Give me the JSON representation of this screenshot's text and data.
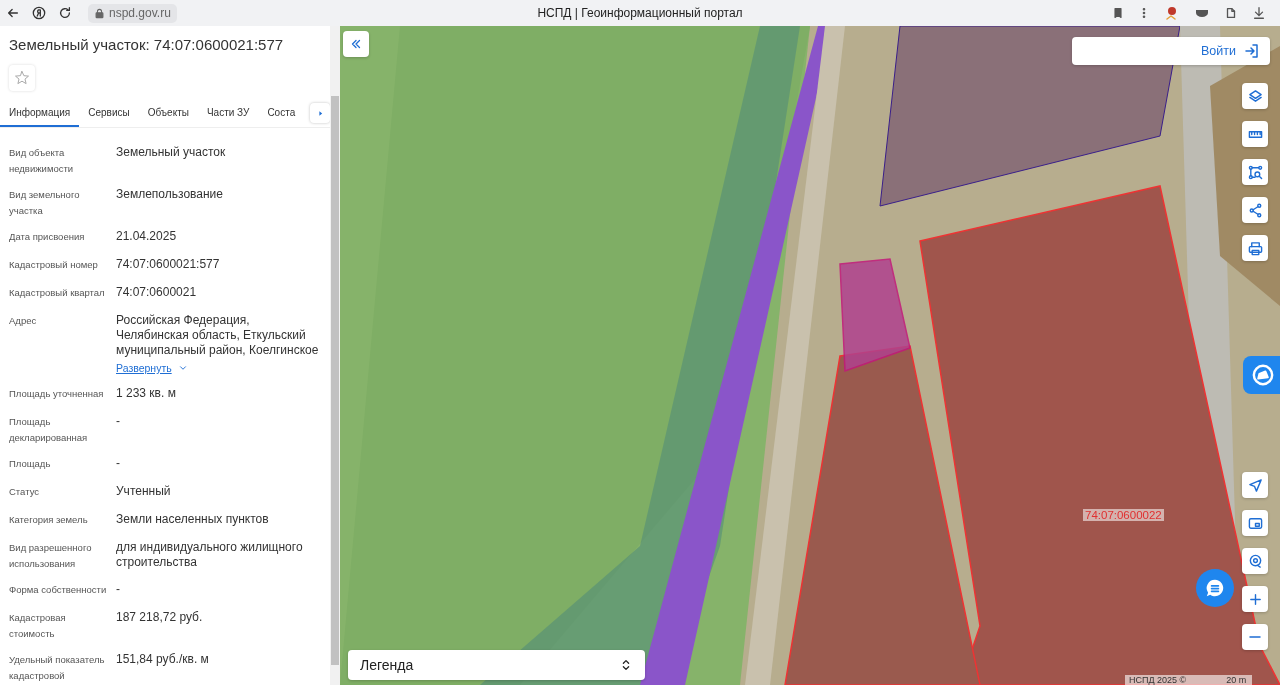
{
  "browser": {
    "url": "nspd.gov.ru",
    "title": "НСПД | Геоинформационный портал"
  },
  "panel": {
    "title": "Земельный участок: 74:07:0600021:577",
    "tabs": [
      {
        "label": "Информация",
        "selected": true
      },
      {
        "label": "Сервисы",
        "selected": false
      },
      {
        "label": "Объекты",
        "selected": false
      },
      {
        "label": "Части ЗУ",
        "selected": false
      },
      {
        "label": "Соста",
        "selected": false
      }
    ],
    "properties": [
      {
        "label": "Вид объекта недвижимости",
        "value": "Земельный участок"
      },
      {
        "label": "Вид земельного участка",
        "value": "Землепользование"
      },
      {
        "label": "Дата присвоения",
        "value": "21.04.2025"
      },
      {
        "label": "Кадастровый номер",
        "value": "74:07:0600021:577"
      },
      {
        "label": "Кадастровый квартал",
        "value": "74:07:0600021"
      },
      {
        "label": "Адрес",
        "value": "Российская Федерация, Челябинская область, Еткульский муниципальный район, Коелгинское",
        "link": "Развернуть"
      },
      {
        "label": "Площадь уточненная",
        "value": "1 233 кв. м"
      },
      {
        "label": "Площадь декларированная",
        "value": "-"
      },
      {
        "label": "Площадь",
        "value": "-"
      },
      {
        "label": "Статус",
        "value": "Учтенный"
      },
      {
        "label": "Категория земель",
        "value": "Земли населенных пунктов"
      },
      {
        "label": "Вид разрешенного использования",
        "value": "для индивидуального жилищного строительства"
      },
      {
        "label": "Форма собственности",
        "value": "-"
      },
      {
        "label": "Кадастровая стоимость",
        "value": "187 218,72 руб."
      },
      {
        "label": "Удельный показатель кадастровой",
        "value": "151,84 руб./кв. м"
      }
    ]
  },
  "map": {
    "login": "Войти",
    "legend": "Легенда",
    "parcel_label": "74:07:0600022",
    "attribution": "НСПД 2025 ©",
    "scale": "20 m"
  }
}
